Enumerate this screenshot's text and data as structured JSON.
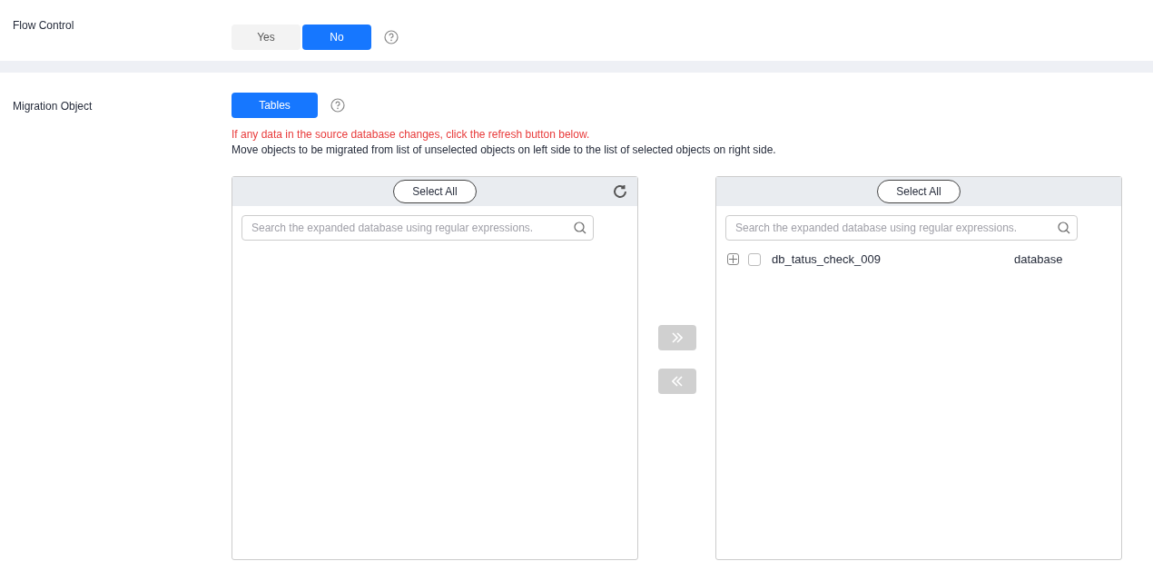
{
  "flow_control": {
    "label": "Flow Control",
    "options": [
      {
        "label": "Yes",
        "selected": false
      },
      {
        "label": "No",
        "selected": true
      }
    ]
  },
  "migration_object": {
    "label": "Migration Object",
    "options": [
      {
        "label": "Tables",
        "selected": true
      }
    ],
    "warning": "If any data in the source database changes, click the refresh button below.",
    "hint": "Move objects to be migrated from list of unselected objects on left side to the list of selected objects on right side.",
    "left_panel": {
      "select_all": "Select All",
      "search": {
        "placeholder": "Search the expanded database using regular expressions."
      }
    },
    "right_panel": {
      "select_all": "Select All",
      "search": {
        "placeholder": "Search the expanded database using regular expressions."
      },
      "items": [
        {
          "name": "db_tatus_check_009",
          "type": "database",
          "checked": false,
          "expanded": false
        }
      ]
    }
  }
}
